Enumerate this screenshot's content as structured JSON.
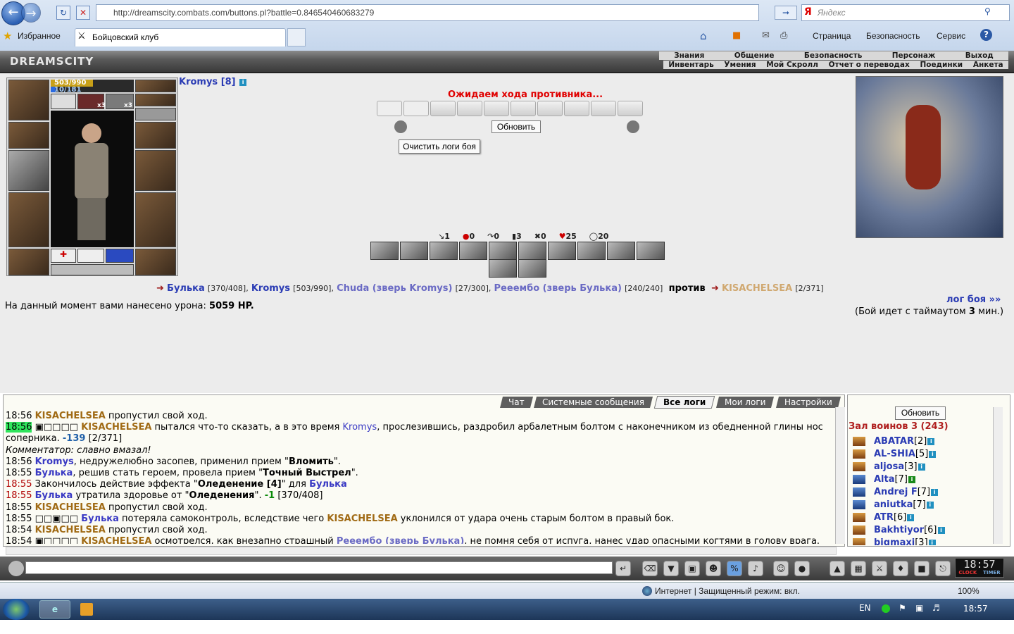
{
  "browser": {
    "url": "http://dreamscity.combats.com/buttons.pl?battle=0.846540460683279",
    "search_placeholder": "Яндекс",
    "favorites": "Избранное",
    "tab_title": "Бойцовский клуб",
    "menu": [
      "Страница",
      "Безопасность",
      "Сервис"
    ],
    "status_zone": "Интернет | Защищенный режим: вкл.",
    "zoom": "100%"
  },
  "game": {
    "logo": "DREAMSCITY",
    "menu_top": [
      "Знания",
      "Общение",
      "Безопасность",
      "Персонаж",
      "Выход"
    ],
    "menu_bottom": [
      "Инвентарь",
      "Умения",
      "Мой Скролл",
      "Отчет о переводах",
      "Поединки",
      "Анкета"
    ],
    "hp": "503/990",
    "mana": "10/181",
    "x3a": "x3",
    "x3b": "x3",
    "player_name": "Kromys [8]",
    "waiting": "Ожидаем хода противника...",
    "refresh": "Обновить",
    "clear_logs": "Очистить логи боя",
    "stats": [
      "1",
      "0",
      "0",
      "3",
      "0",
      "25",
      "20"
    ],
    "fighters": {
      "f1": "Булька",
      "f1v": "[370/408],",
      "f2": "Kromys",
      "f2v": "[503/990],",
      "f3": "Chuda (зверь Kromys)",
      "f3v": "[27/300],",
      "f4": "Рееембо (зверь Булька)",
      "f4v": "[240/240]",
      "vs": "против",
      "e1": "KISACHELSEA",
      "e1v": "[2/371]"
    },
    "damage_label": "На данный момент вами нанесено урона:",
    "damage_value": "5059 HP.",
    "log_link": "лог боя »»",
    "timeout_a": "(Бой идет с таймаутом",
    "timeout_n": "3",
    "timeout_b": "мин.)"
  },
  "chat": {
    "tabs": [
      "Чат",
      "Системные сообщения",
      "Все логи",
      "Мои логи",
      "Настройки"
    ],
    "lines": {
      "l1t": "18:56",
      "l1n": "KISACHELSEA",
      "l1x": " пропустил свой ход.",
      "l2t": "18:56",
      "l2n": "KISACHELSEA",
      "l2x": " пытался что-то сказать, а в это время ",
      "l2n2": "Kromys",
      "l2x2": ", прослезившись, раздробил арбалетным болтом с наконечником из обедненной глины нос",
      "l3x": "соперника. ",
      "l3v": "-139",
      "l3y": " [2/371]",
      "l4x": "Комментатор: славно вмазал!",
      "l5t": "18:56",
      "l5n": "Kromys",
      "l5x": ", недружелюбно засопев, применил прием \"",
      "l5b": "Вломить",
      "l5y": "\".",
      "l6t": "18:55",
      "l6n": "Булька",
      "l6x": ", решив стать героем, провела прием \"",
      "l6b": "Точный Выстрел",
      "l6y": "\".",
      "l7t": "18:55",
      "l7x": " Закончилось действие эффекта \"",
      "l7b": "Оледенение [4]",
      "l7y": "\" для ",
      "l7n": "Булька",
      "l8t": "18:55",
      "l8n": "Булька",
      "l8x": " утратила здоровье от \"",
      "l8b": "Оледенения",
      "l8y": "\". ",
      "l8v": "-1",
      "l8z": " [370/408]",
      "l9t": "18:55",
      "l9n": "KISACHELSEA",
      "l9x": " пропустил свой ход.",
      "l10t": "18:55",
      "l10n": "Булька",
      "l10x": " потеряла самоконтроль, вследствие чего ",
      "l10n2": "KISACHELSEA",
      "l10y": " уклонился от удара очень старым болтом в правый бок.",
      "l11t": "18:54",
      "l11n": "KISACHELSEA",
      "l11x": " пропустил свой ход.",
      "l12t": "18:54",
      "l12n": "KISACHELSEA",
      "l12x": " осмотрелся, как внезапно страшный ",
      "l12n2": "Рееембо (зверь Булька)",
      "l12y": ", не помня себя от испуга, нанес удар опасными когтями в голову врага."
    }
  },
  "hall": {
    "refresh": "Обновить",
    "title": "Зал воинов 3 (243)",
    "users": [
      {
        "name": "ABATAR",
        "lv": "[2]"
      },
      {
        "name": "AL-SHIA",
        "lv": "[5]"
      },
      {
        "name": "aljosa",
        "lv": "[3]"
      },
      {
        "name": "Alta",
        "lv": "[7]"
      },
      {
        "name": "Andrej F",
        "lv": "[7]"
      },
      {
        "name": "aniutka",
        "lv": "[7]"
      },
      {
        "name": "ATR",
        "lv": "[6]"
      },
      {
        "name": "Bakhtiyor",
        "lv": "[6]"
      },
      {
        "name": "bigmaxi",
        "lv": "[3]"
      }
    ]
  },
  "clock": "18:57",
  "clock_labels": [
    "CLOCK",
    "TIMER"
  ],
  "taskbar": {
    "lang": "EN",
    "time": "18:57"
  }
}
